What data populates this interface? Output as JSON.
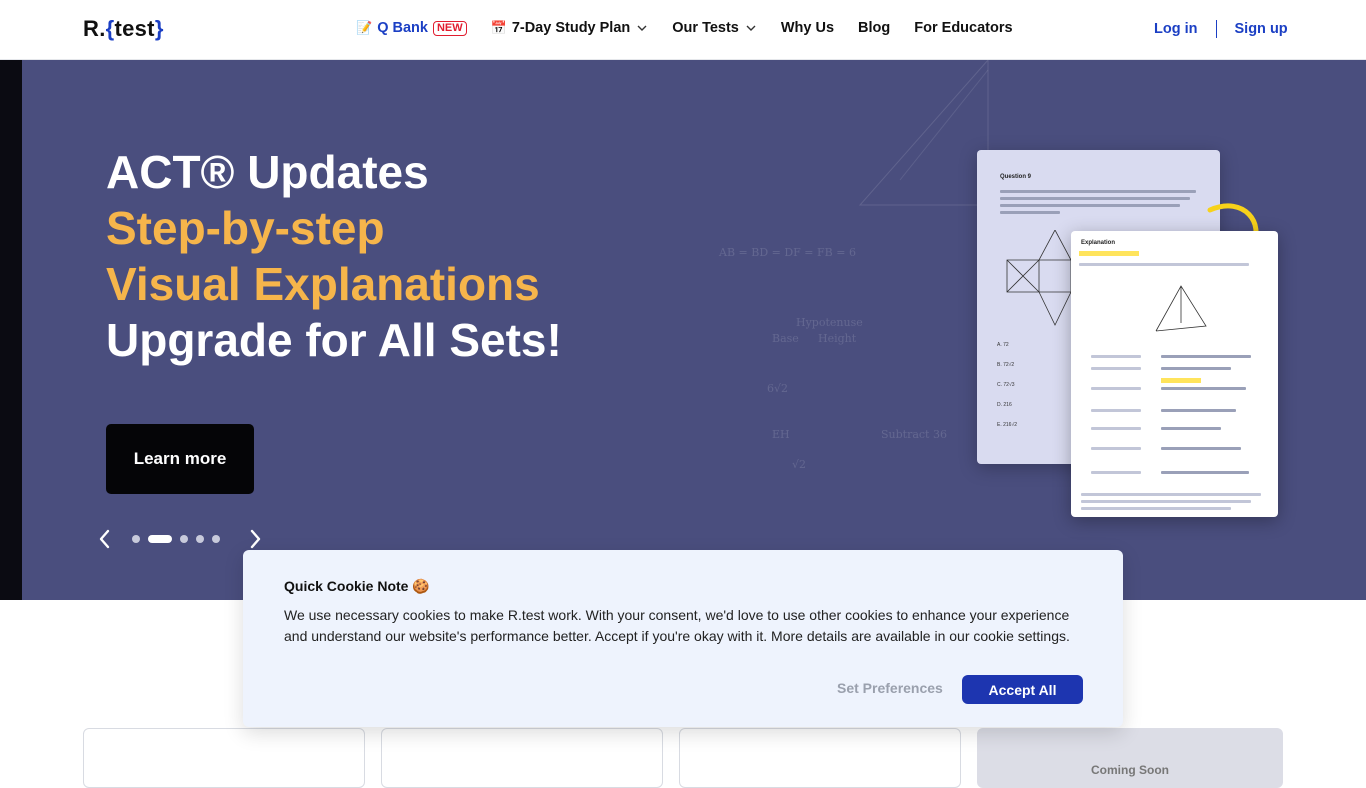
{
  "header": {
    "logo_prefix": "R.",
    "logo_open": "{",
    "logo_word": "test",
    "logo_close": "}",
    "nav": [
      {
        "label": "Q Bank",
        "emoji": "📝",
        "badge": "NEW"
      },
      {
        "label": "7-Day Study Plan",
        "emoji": "📅"
      },
      {
        "label": "Our Tests"
      },
      {
        "label": "Why Us"
      },
      {
        "label": "Blog"
      },
      {
        "label": "For Educators"
      }
    ],
    "login": "Log in",
    "signup": "Sign up"
  },
  "hero": {
    "line1": "ACT® Updates",
    "line2": "Step-by-step",
    "line3": "Visual Explanations",
    "line4": "Upgrade for All Sets!",
    "cta": "Learn more",
    "slides_total": 5,
    "active_slide": 2,
    "card1_title": "Question 9",
    "card2_title": "Explanation",
    "choices": [
      "A. 72",
      "B. 72√2",
      "C. 72√3",
      "D. 216",
      "E. 216√2"
    ],
    "bg_math": [
      "AB = BD = DF = FB = 6",
      "Hypotenuse",
      "Base",
      "Height",
      "Subtract 36",
      "6√2",
      "EH",
      "√2"
    ]
  },
  "cookie": {
    "title": "Quick Cookie Note 🍪",
    "body": "We use necessary cookies to make R.test work. With your consent, we'd love to use other cookies to enhance your experience and understand our website's performance better. Accept if you're okay with it. More details are available in our cookie settings.",
    "preferences": "Set Preferences",
    "accept": "Accept All"
  },
  "bottom": {
    "coming_soon": "Coming Soon"
  },
  "colors": {
    "brand_blue": "#1b3fc4",
    "hero_bg": "#4a4e7e",
    "accent_yellow": "#f6b54b",
    "badge_red": "#e11d2f"
  }
}
